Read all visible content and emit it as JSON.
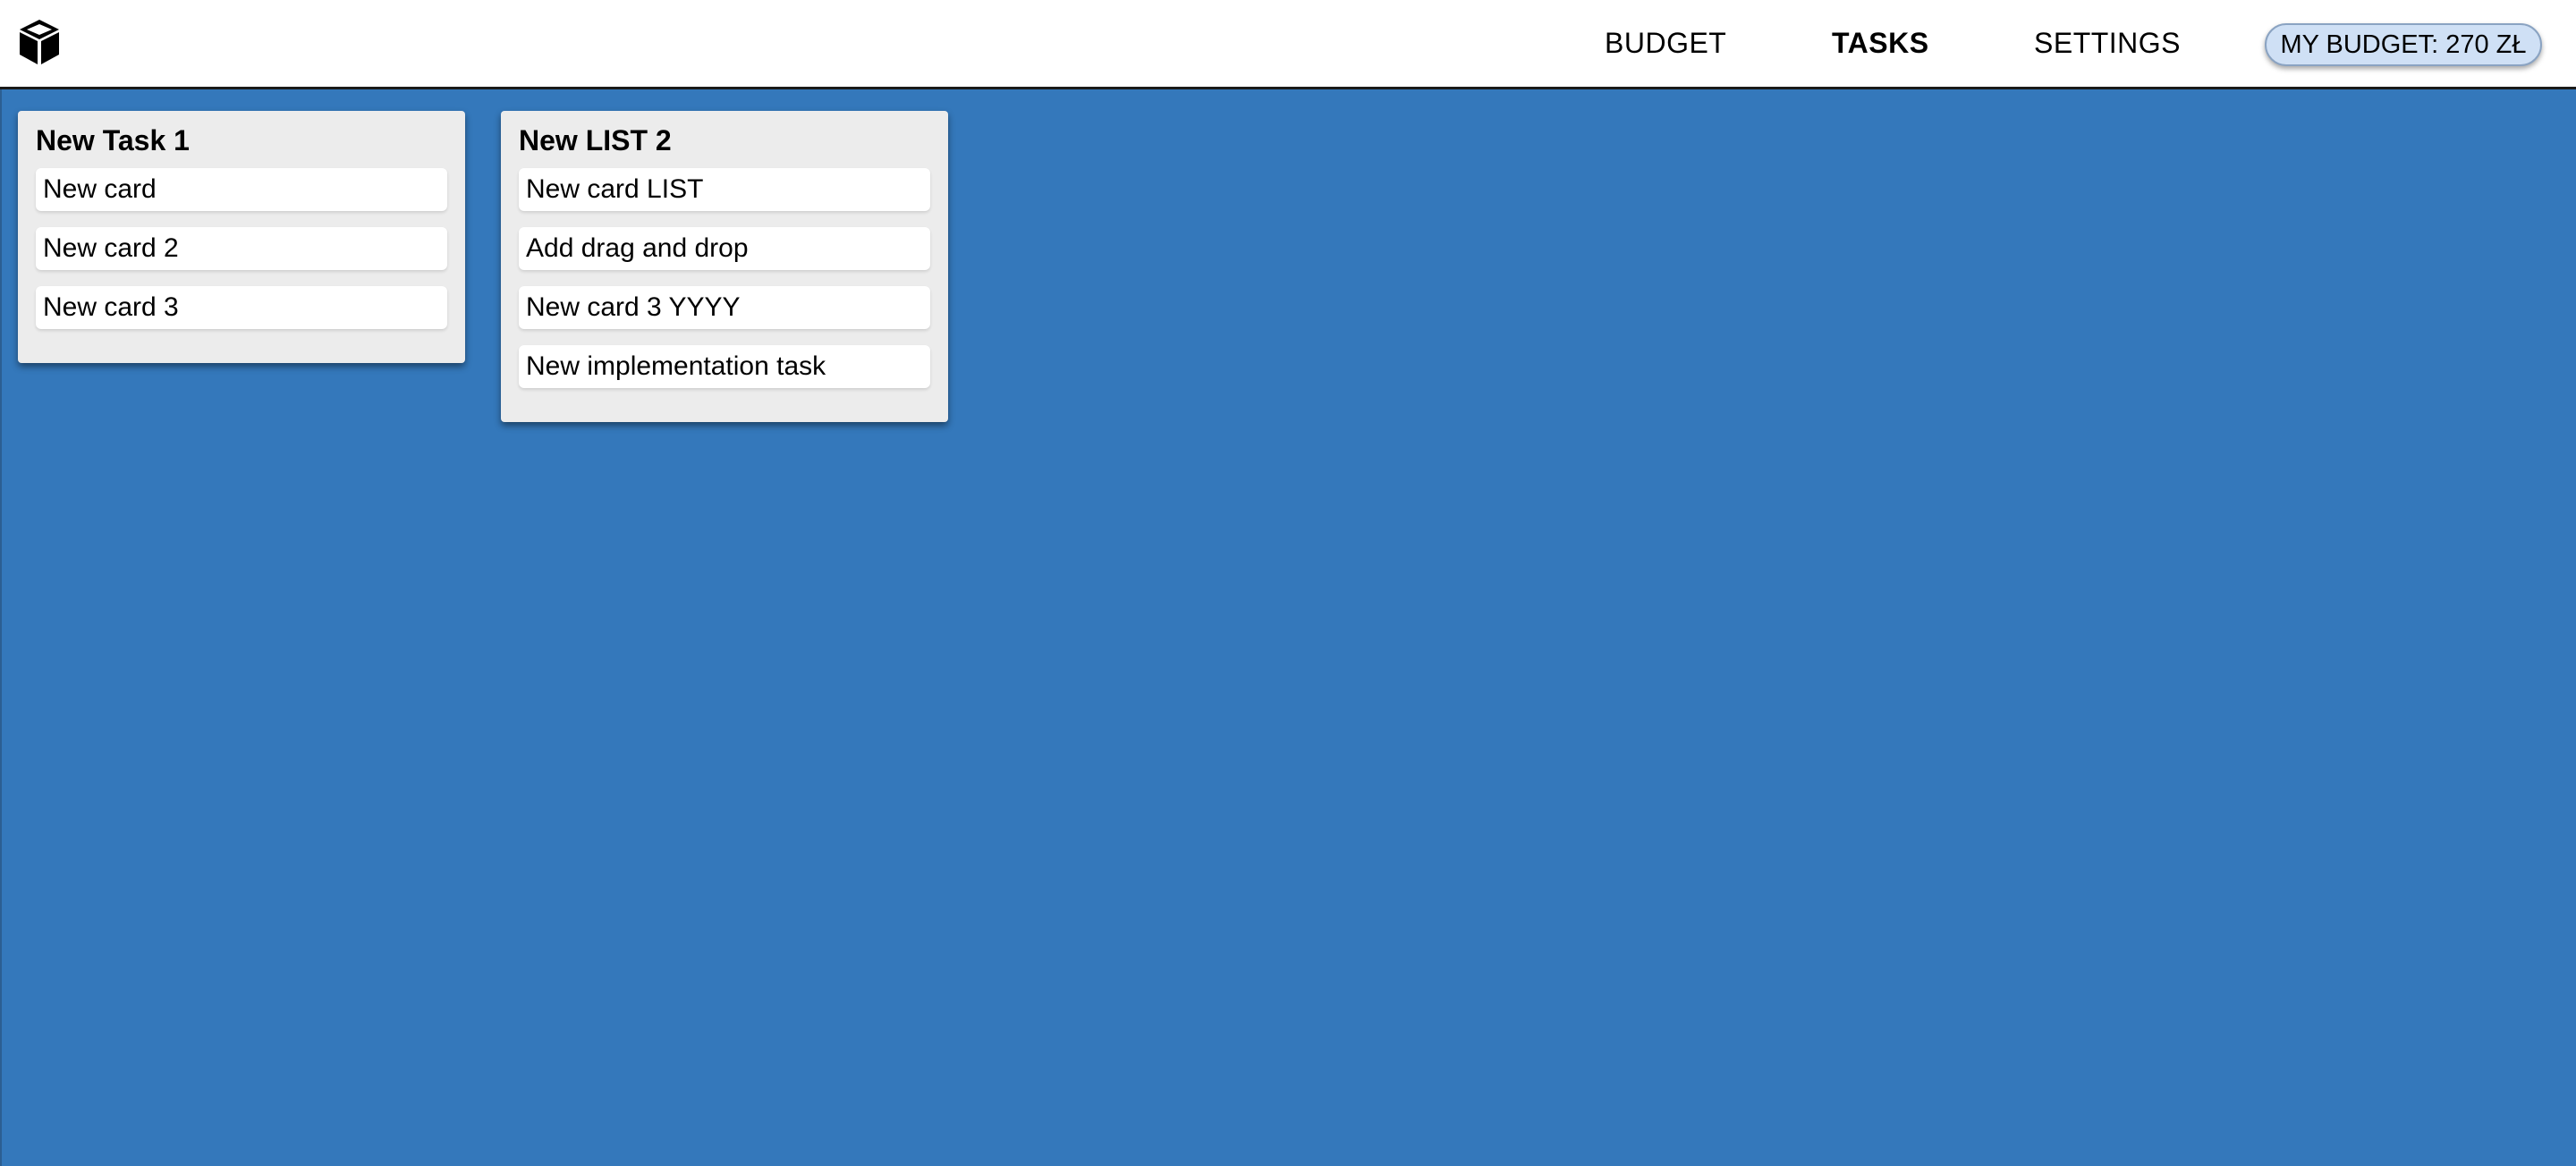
{
  "header": {
    "logo_icon": "cube-icon",
    "nav": {
      "budget_label": "BUDGET",
      "tasks_label": "TASKS",
      "settings_label": "SETTINGS"
    },
    "budget_badge": "MY BUDGET: 270 ZŁ"
  },
  "colors": {
    "board_background": "#3478bb",
    "list_background": "#ececec",
    "card_background": "#ffffff",
    "badge_background": "#cfe0f5"
  },
  "board": {
    "lists": [
      {
        "title": "New Task 1",
        "cards": [
          "New card",
          "New card 2",
          "New card 3"
        ]
      },
      {
        "title": "New LIST 2",
        "cards": [
          "New card LIST",
          "Add drag and drop",
          "New card 3 YYYY",
          "New implementation task"
        ]
      }
    ]
  }
}
